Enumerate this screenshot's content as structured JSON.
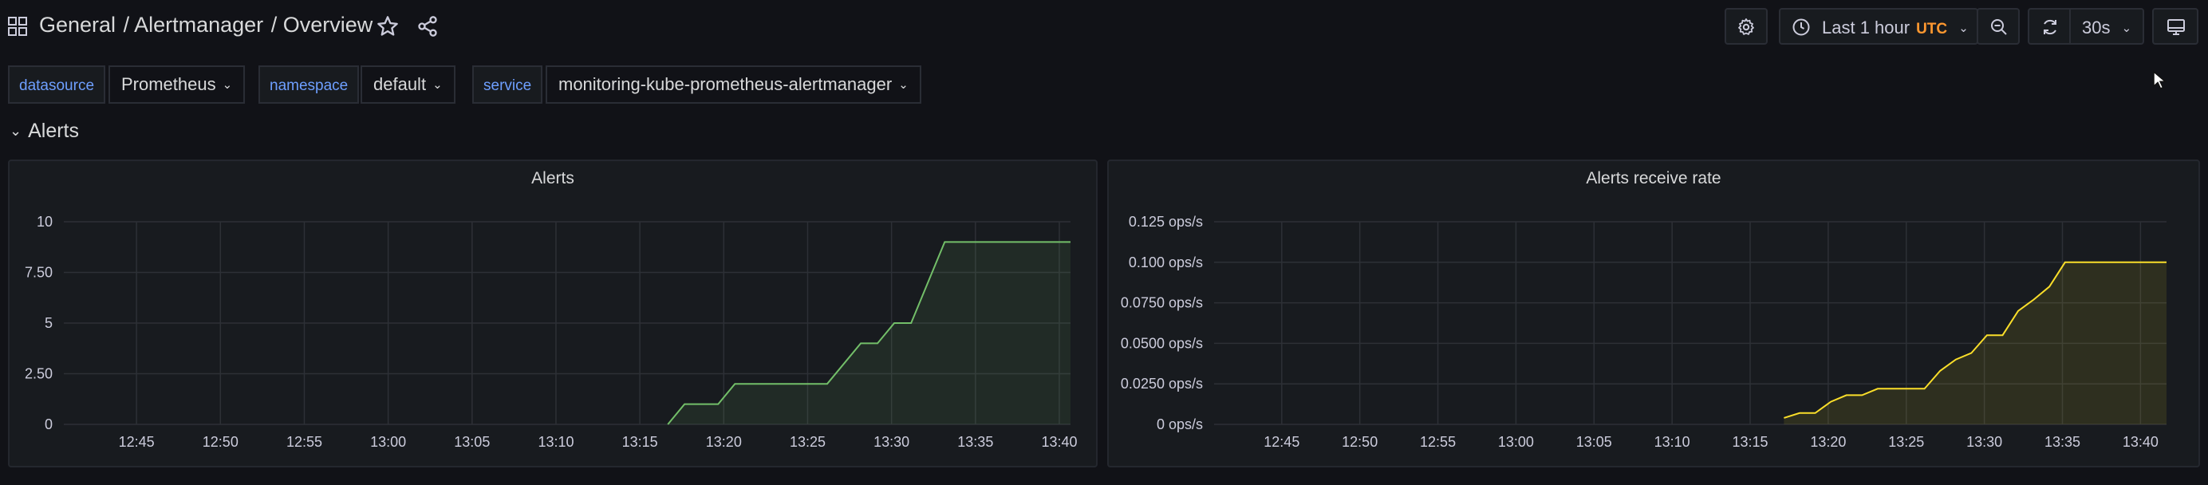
{
  "header": {
    "breadcrumb": [
      "General",
      "/ Alertmanager",
      "/ Overview"
    ],
    "time_range": "Last 1 hour",
    "timezone": "UTC",
    "refresh_interval": "30s"
  },
  "variables": [
    {
      "label": "datasource",
      "value": "Prometheus"
    },
    {
      "label": "namespace",
      "value": "default"
    },
    {
      "label": "service",
      "value": "monitoring-kube-prometheus-alertmanager"
    }
  ],
  "row": {
    "title": "Alerts"
  },
  "colors": {
    "background": "#111217",
    "panel": "#181b1f",
    "series_green": "#73bf69",
    "series_yellow": "#fade2a",
    "accent_orange": "#ff9830",
    "variable_label": "#6e9fff"
  },
  "icons": [
    "apps-icon",
    "star-icon",
    "share-icon",
    "gear-icon",
    "clock-icon",
    "chevron-down-icon",
    "zoom-out-icon",
    "refresh-icon",
    "tv-icon"
  ],
  "chart_data": [
    {
      "type": "area",
      "title": "Alerts",
      "x_ticks": [
        "12:45",
        "12:50",
        "12:55",
        "13:00",
        "13:05",
        "13:10",
        "13:15",
        "13:20",
        "13:25",
        "13:30",
        "13:35",
        "13:40"
      ],
      "y_ticks": [
        "0",
        "2.50",
        "5",
        "7.50",
        "10"
      ],
      "ylim": [
        0,
        10
      ],
      "xlim": [
        "12:40:40",
        "13:40:40"
      ],
      "grid": true,
      "series": [
        {
          "color": "#73bf69",
          "x": [
            "13:16:40",
            "13:17:40",
            "13:19:40",
            "13:20:40",
            "13:26:10",
            "13:28:10",
            "13:29:10",
            "13:30:10",
            "13:31:10",
            "13:33:10",
            "13:40:40"
          ],
          "y": [
            0,
            1,
            1,
            2,
            2,
            4,
            4,
            5,
            5,
            9,
            9
          ]
        }
      ]
    },
    {
      "type": "area",
      "title": "Alerts receive rate",
      "x_ticks": [
        "12:45",
        "12:50",
        "12:55",
        "13:00",
        "13:05",
        "13:10",
        "13:15",
        "13:20",
        "13:25",
        "13:30",
        "13:35",
        "13:40"
      ],
      "y_ticks": [
        "0 ops/s",
        "0.0250 ops/s",
        "0.0500 ops/s",
        "0.0750 ops/s",
        "0.100 ops/s",
        "0.125 ops/s"
      ],
      "ylim": [
        0,
        0.125
      ],
      "xlim": [
        "12:40:40",
        "13:41:40"
      ],
      "grid": true,
      "series": [
        {
          "color": "#fade2a",
          "x": [
            "13:17:10",
            "13:18:10",
            "13:19:10",
            "13:20:10",
            "13:21:10",
            "13:22:10",
            "13:23:10",
            "13:24:10",
            "13:26:10",
            "13:27:10",
            "13:28:10",
            "13:29:10",
            "13:30:10",
            "13:31:10",
            "13:32:10",
            "13:33:10",
            "13:34:10",
            "13:35:10",
            "13:41:40"
          ],
          "y": [
            0.004,
            0.007,
            0.007,
            0.014,
            0.018,
            0.018,
            0.022,
            0.022,
            0.022,
            0.033,
            0.04,
            0.044,
            0.055,
            0.055,
            0.07,
            0.077,
            0.085,
            0.1,
            0.1
          ]
        }
      ]
    }
  ]
}
